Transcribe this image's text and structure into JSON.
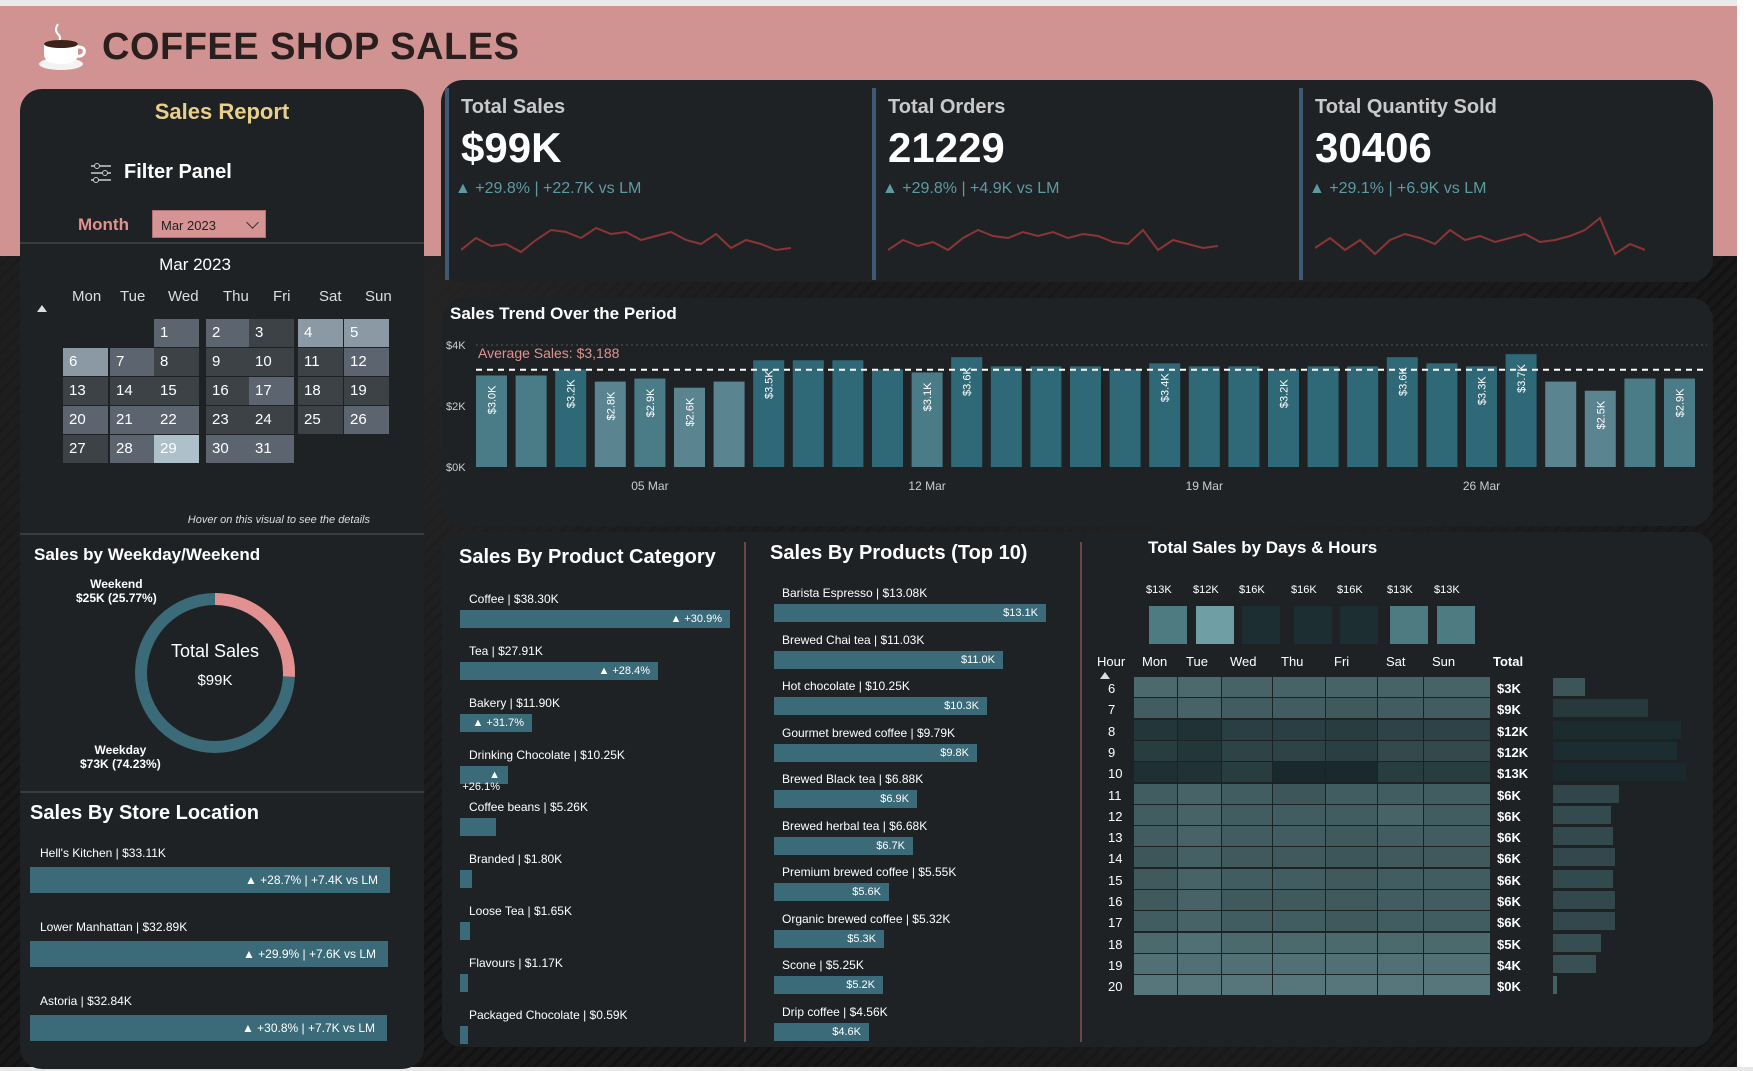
{
  "header": {
    "title": "COFFEE SHOP SALES"
  },
  "sidebar": {
    "report_title": "Sales Report",
    "filter_label": "Filter Panel",
    "month_label": "Month",
    "month_value": "Mar 2023",
    "calendar_title": "Mar 2023",
    "weekdays": [
      "Mon",
      "Tue",
      "Wed",
      "Thu",
      "Fri",
      "Sat",
      "Sun"
    ],
    "hint": "Hover on this visual to see the details"
  },
  "kpis": [
    {
      "label": "Total Sales",
      "value": "$99K",
      "change": "▲ +29.8% | +22.7K vs LM"
    },
    {
      "label": "Total Orders",
      "value": "21229",
      "change": "▲ +29.8% | +4.9K vs LM"
    },
    {
      "label": "Total Quantity Sold",
      "value": "30406",
      "change": "▲ +29.1% | +6.9K vs LM"
    }
  ],
  "weekday_weekend": {
    "title": "Sales by Weekday/Weekend",
    "weekend_label": "Weekend",
    "weekend_value": "$25K (25.77%)",
    "weekday_label": "Weekday",
    "weekday_value": "$73K (74.23%)",
    "center_label": "Total Sales",
    "center_value": "$99K",
    "weekend_share": 0.2577
  },
  "store": {
    "title": "Sales By Store Location",
    "items": [
      {
        "name": "Hell's Kitchen | $33.11K",
        "change": "▲ +28.7% | +7.4K vs LM"
      },
      {
        "name": "Lower Manhattan | $32.89K",
        "change": "▲ +29.9% | +7.6K vs LM"
      },
      {
        "name": "Astoria | $32.84K",
        "change": "▲ +30.8% | +7.7K vs LM"
      }
    ]
  },
  "trend": {
    "title": "Sales Trend Over the Period",
    "avg_label": "Average Sales: $3,188",
    "y_ticks": [
      "$4K",
      "$2K",
      "$0K"
    ],
    "x_ticks": [
      "05 Mar",
      "12 Mar",
      "19 Mar",
      "26 Mar"
    ]
  },
  "category": {
    "title": "Sales By Product Category",
    "items": [
      {
        "label": "Coffee | $38.30K",
        "change": "▲ +30.9%"
      },
      {
        "label": "Tea | $27.91K",
        "change": "▲ +28.4%"
      },
      {
        "label": "Bakery | $11.90K",
        "change": "▲ +31.7%"
      },
      {
        "label": "Drinking Chocolate | $10.25K",
        "change": "▲ +26.1%"
      },
      {
        "label": "Coffee beans | $5.26K",
        "change": ""
      },
      {
        "label": "Branded | $1.80K",
        "change": ""
      },
      {
        "label": "Loose Tea | $1.65K",
        "change": ""
      },
      {
        "label": "Flavours | $1.17K",
        "change": ""
      },
      {
        "label": "Packaged Chocolate | $0.59K",
        "change": ""
      }
    ]
  },
  "products": {
    "title": "Sales By Products (Top 10)",
    "items": [
      {
        "label": "Barista Espresso | $13.08K",
        "bar": "$13.1K"
      },
      {
        "label": "Brewed Chai tea | $11.03K",
        "bar": "$11.0K"
      },
      {
        "label": "Hot chocolate | $10.25K",
        "bar": "$10.3K"
      },
      {
        "label": "Gourmet brewed coffee | $9.79K",
        "bar": "$9.8K"
      },
      {
        "label": "Brewed Black tea | $6.88K",
        "bar": "$6.9K"
      },
      {
        "label": "Brewed herbal tea | $6.68K",
        "bar": "$6.7K"
      },
      {
        "label": "Premium brewed coffee | $5.55K",
        "bar": "$5.6K"
      },
      {
        "label": "Organic brewed coffee | $5.32K",
        "bar": "$5.3K"
      },
      {
        "label": "Scone | $5.25K",
        "bar": "$5.2K"
      },
      {
        "label": "Drip coffee | $4.56K",
        "bar": "$4.6K"
      }
    ]
  },
  "heatmap": {
    "title": "Total Sales by Days & Hours",
    "hour_label": "Hour",
    "total_label": "Total",
    "day_totals": [
      "$13K",
      "$12K",
      "$16K",
      "$16K",
      "$16K",
      "$13K",
      "$13K"
    ],
    "days": [
      "Mon",
      "Tue",
      "Wed",
      "Thu",
      "Fri",
      "Sat",
      "Sun"
    ],
    "hours": [
      "6",
      "7",
      "8",
      "9",
      "10",
      "11",
      "12",
      "13",
      "14",
      "15",
      "16",
      "17",
      "18",
      "19",
      "20"
    ],
    "hour_totals": [
      "$3K",
      "$9K",
      "$12K",
      "$12K",
      "$13K",
      "$6K",
      "$6K",
      "$6K",
      "$6K",
      "$6K",
      "$6K",
      "$6K",
      "$5K",
      "$4K",
      "$0K"
    ]
  },
  "chart_data": {
    "type": "bar",
    "title": "Sales Trend Over the Period",
    "x": [
      "01 Mar",
      "02 Mar",
      "03 Mar",
      "04 Mar",
      "05 Mar",
      "06 Mar",
      "07 Mar",
      "08 Mar",
      "09 Mar",
      "10 Mar",
      "11 Mar",
      "12 Mar",
      "13 Mar",
      "14 Mar",
      "15 Mar",
      "16 Mar",
      "17 Mar",
      "18 Mar",
      "19 Mar",
      "20 Mar",
      "21 Mar",
      "22 Mar",
      "23 Mar",
      "24 Mar",
      "25 Mar",
      "26 Mar",
      "27 Mar",
      "28 Mar",
      "29 Mar",
      "30 Mar",
      "31 Mar"
    ],
    "values": [
      3.0,
      3.0,
      3.2,
      2.8,
      2.9,
      2.6,
      2.8,
      3.5,
      3.5,
      3.5,
      3.2,
      3.1,
      3.6,
      3.3,
      3.3,
      3.3,
      3.2,
      3.4,
      3.3,
      3.3,
      3.2,
      3.3,
      3.3,
      3.6,
      3.4,
      3.3,
      3.7,
      2.8,
      2.5,
      2.9,
      2.9
    ],
    "labels": [
      "$3.0K",
      "",
      "$3.2K",
      "$2.8K",
      "$2.9K",
      "$2.6K",
      "",
      "$3.5K",
      "",
      "",
      "",
      "$3.1K",
      "$3.6K",
      "",
      "",
      "",
      "",
      "$3.4K",
      "",
      "",
      "$3.2K",
      "",
      "",
      "$3.6K",
      "",
      "$3.3K",
      "$3.7K",
      "",
      "$2.5K",
      "",
      "$2.9K"
    ],
    "ylim": [
      0,
      4
    ],
    "average": 3.188,
    "ylabel": ""
  },
  "colors": {
    "accent": "#3b6b79",
    "header": "#d09392",
    "panel": "#1f2225",
    "gold": "#e9cf8a",
    "pink": "#e39190"
  }
}
